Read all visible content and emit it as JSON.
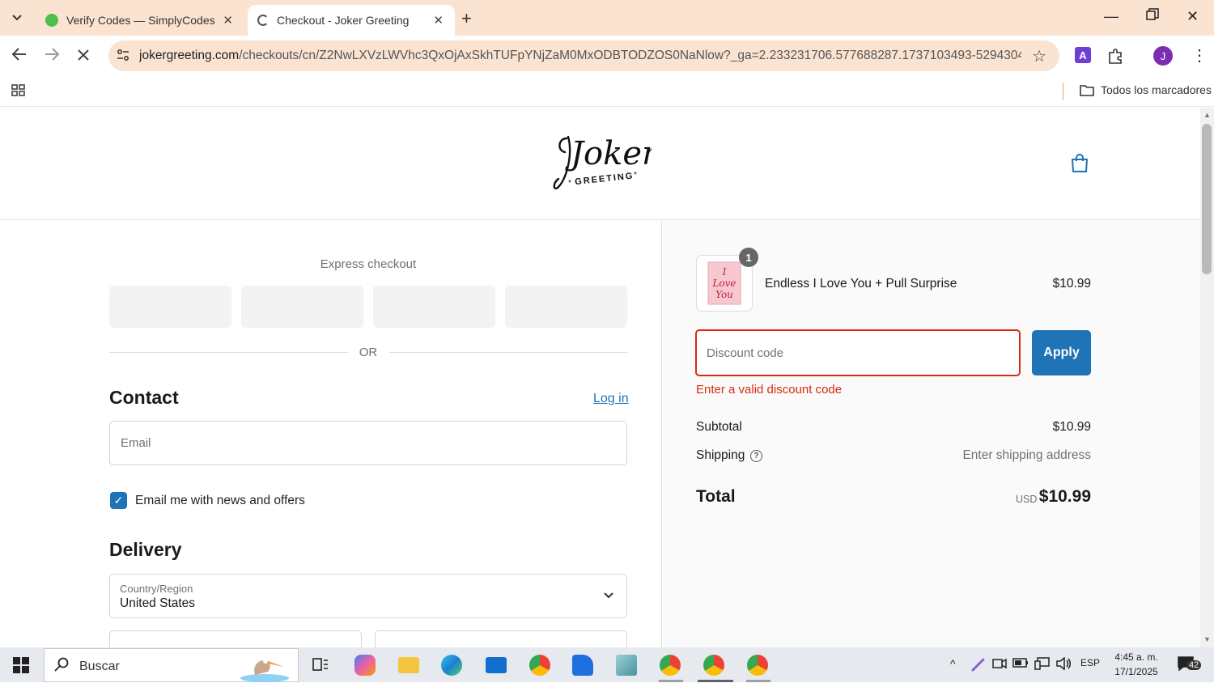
{
  "browser": {
    "tabs": [
      {
        "title": "Verify Codes — SimplyCodes",
        "active": false
      },
      {
        "title": "Checkout - Joker Greeting",
        "active": true
      }
    ],
    "url_host": "jokergreeting.com",
    "url_path": "/checkouts/cn/Z2NwLXVzLWVhc3QxOjAxSkhTUFpYNjZaM0MxODBTODZOS0NaNlow?_ga=2.233231706.577688287.1737103493-529430494...",
    "bookmarks_label": "Todos los marcadores",
    "profile_initial": "J",
    "accent_color": "#fbe3d1"
  },
  "header": {
    "brand_script": "Joker",
    "brand_sub": "GREETING"
  },
  "checkout": {
    "express_title": "Express checkout",
    "or_text": "OR",
    "contact_title": "Contact",
    "login_label": "Log in",
    "email_placeholder": "Email",
    "marketing_label": "Email me with news and offers",
    "delivery_title": "Delivery",
    "country_label": "Country/Region",
    "country_value": "United States"
  },
  "summary": {
    "product_name": "Endless I Love You + Pull Surprise",
    "product_qty": "1",
    "product_price": "$10.99",
    "discount_placeholder": "Discount code",
    "apply_label": "Apply",
    "error_text": "Enter a valid discount code",
    "subtotal_label": "Subtotal",
    "subtotal_value": "$10.99",
    "shipping_label": "Shipping",
    "shipping_value": "Enter shipping address",
    "total_label": "Total",
    "total_currency": "USD",
    "total_value": "$10.99",
    "accent_color": "#1f73b7",
    "error_color": "#d82c0d"
  },
  "taskbar": {
    "search_label": "Buscar",
    "language": "ESP",
    "time": "4:45 a. m.",
    "date": "17/1/2025",
    "notification_count": "42"
  }
}
